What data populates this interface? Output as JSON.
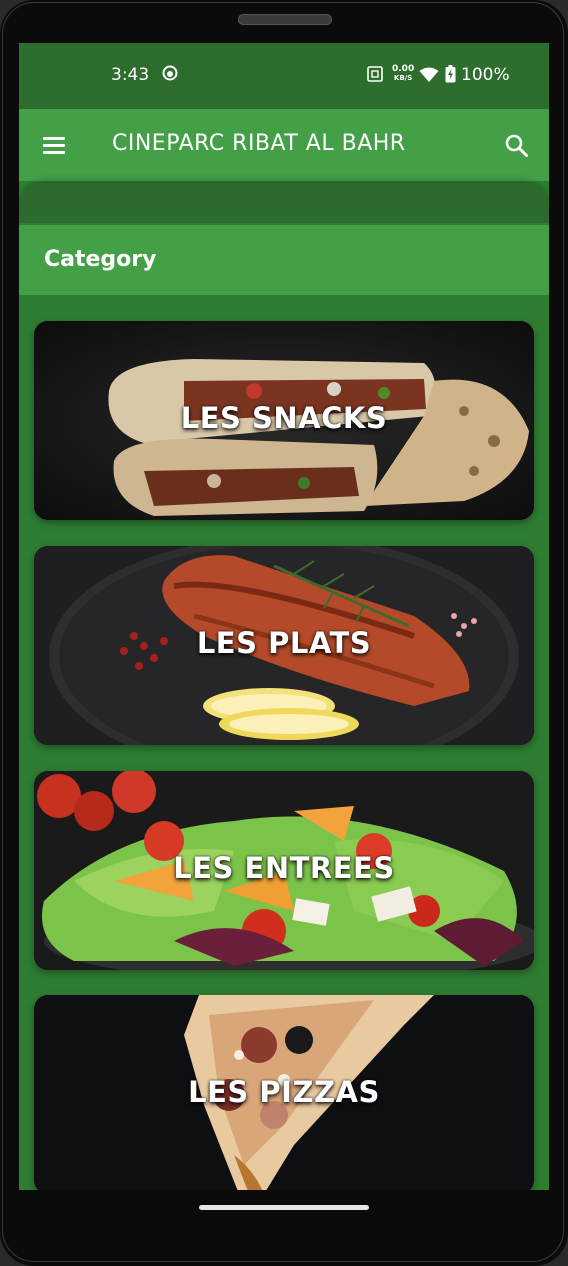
{
  "status_bar": {
    "time": "3:43",
    "net_speed_value": "0.00",
    "net_speed_unit": "KB/S",
    "battery_percent": "100%"
  },
  "app_bar": {
    "title": "CINEPARC RIBAT AL BAHR"
  },
  "category_header": {
    "label": "Category"
  },
  "categories": [
    {
      "label": "LES SNACKS",
      "image_icon": "wrap-sandwich-image"
    },
    {
      "label": "LES PLATS",
      "image_icon": "salmon-plate-image"
    },
    {
      "label": "LES ENTREES",
      "image_icon": "salad-plate-image"
    },
    {
      "label": "LES PIZZAS",
      "image_icon": "pizza-slice-image"
    }
  ],
  "colors": {
    "status_bar": "#2d6e2f",
    "app_bar": "#43a047",
    "background": "#2e7d32"
  }
}
